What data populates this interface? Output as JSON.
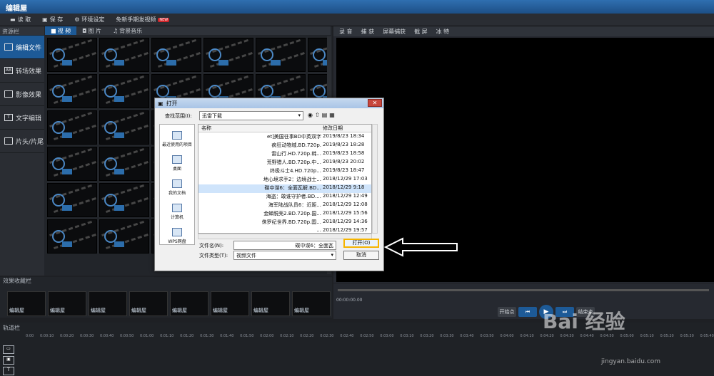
{
  "app": {
    "title": "编辑屋"
  },
  "toolbar": {
    "read": "读 取",
    "save": "保 存",
    "settings": "环境设定",
    "tutorial": "免新手期发视频",
    "new_badge": "NEW"
  },
  "left": {
    "resource_label": "资源栏",
    "tabs": [
      "视 频",
      "图 片",
      "背景音乐"
    ],
    "sidebar": [
      "编辑文件",
      "转场效果",
      "影像效果",
      "文字编辑",
      "片头/片尾"
    ],
    "sidebar_icons": [
      "video-icon",
      "ab-transition-icon",
      "effect-icon",
      "text-icon",
      "film-icon"
    ]
  },
  "right": {
    "tabs": [
      "录 音",
      "捕 获",
      "屏幕捕获",
      "截 屏",
      "冰 特"
    ]
  },
  "favorites": {
    "label": "效果收藏栏",
    "thumb_label": "编辑屋"
  },
  "player": {
    "time": "00:00:00.00",
    "start": "开始点",
    "end": "结束点"
  },
  "timeline": {
    "label": "轨道栏",
    "ticks": [
      "0:00",
      "0:00:10",
      "0:00:20",
      "0:00:30",
      "0:00:40",
      "0:00:50",
      "0:01:00",
      "0:01:10",
      "0:01:20",
      "0:01:30",
      "0:01:40",
      "0:01:50",
      "0:02:00",
      "0:02:10",
      "0:02:20",
      "0:02:30",
      "0:02:40",
      "0:02:50",
      "0:03:00",
      "0:03:10",
      "0:03:20",
      "0:03:30",
      "0:03:40",
      "0:03:50",
      "0:04:00",
      "0:04:10",
      "0:04:20",
      "0:04:30",
      "0:04:40",
      "0:04:50",
      "0:05:00",
      "0:05:10",
      "0:05:20",
      "0:05:30",
      "0:05:40"
    ]
  },
  "dialog": {
    "title": "打开",
    "look_in_label": "查找范围(I):",
    "look_in_value": "迅雷下载",
    "places": [
      "最近使用的项目",
      "桌面",
      "我的文档",
      "计算机",
      "WPS网盘"
    ],
    "headers": [
      "名称",
      "修改日期"
    ],
    "files": [
      {
        "name": "et]美国往事BD中英双字",
        "date": "2019/8/23 18:34"
      },
      {
        "name": "疯狂动物城.BD.720p.",
        "date": "2019/8/23 18:28"
      },
      {
        "name": "雷山行.HD.720p.韩...",
        "date": "2019/8/23 18:58"
      },
      {
        "name": "荒野猎人.BD.720p.中...",
        "date": "2019/8/23 20:02"
      },
      {
        "name": "终极斗士4.HD.720p...",
        "date": "2019/8/23 18:47"
      },
      {
        "name": "地心境求手2：边境战士...",
        "date": "2018/12/29 17:03"
      },
      {
        "name": "碟中谍6：全面瓦解.BD...",
        "date": "2018/12/29 9:18"
      },
      {
        "name": "海盗：敢谁守护者.BD....",
        "date": "2018/12/29 12:49"
      },
      {
        "name": "海军陆战队员6：近距...",
        "date": "2018/12/29 12:08"
      },
      {
        "name": "金蝉脱壳2.BD.720p.国...",
        "date": "2018/12/29 15:56"
      },
      {
        "name": "侏罗纪世界.BD.720p.国...",
        "date": "2018/12/29 14:36"
      },
      {
        "name": "...",
        "date": "2018/12/29 19:57"
      }
    ],
    "filename_label": "文件名(N):",
    "filename_value": "碟中谍6：全面瓦",
    "filetype_label": "文件类型(T):",
    "filetype_value": "视频文件",
    "open": "打开(O)",
    "cancel": "取消"
  },
  "watermark": {
    "text": "Bai 经验",
    "url": "jingyan.baidu.com"
  }
}
